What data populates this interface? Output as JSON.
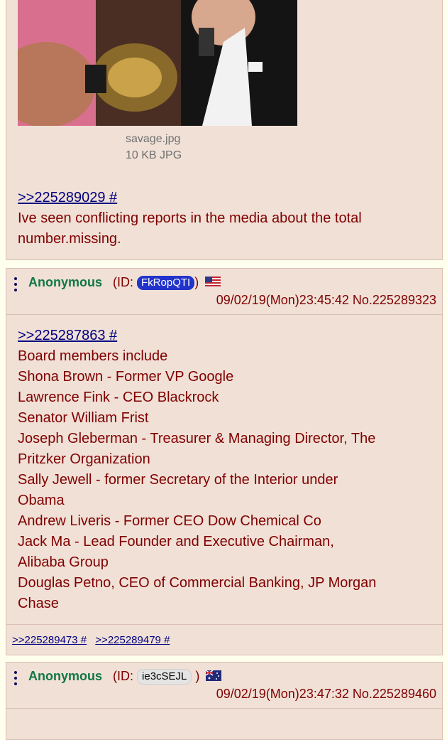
{
  "post1": {
    "file_name": "savage.jpg",
    "file_size": "10 KB JPG",
    "quote": ">>225289029 #",
    "message_lines": [
      "Ive seen conflicting reports in the media about the total",
      "number.missing."
    ]
  },
  "post2": {
    "name": "Anonymous",
    "id_prefix": "(ID:",
    "id": "FkRopQTI",
    "id_suffix": ")",
    "flag_icon": "us-flag-icon",
    "datetime": "09/02/19(Mon)23:45:42",
    "post_no": "No.225289323",
    "quote": ">>225287863 #",
    "message_lines": [
      "Board members include",
      "Shona Brown - Former VP Google",
      "Lawrence Fink - CEO Blackrock",
      "Senator William Frist",
      "Joseph Gleberman - Treasurer & Managing Director, The",
      "Pritzker Organization",
      "Sally Jewell - former Secretary of the Interior under",
      "Obama",
      "Andrew Liveris - Former CEO Dow Chemical Co",
      "Jack Ma - Lead Founder and Executive Chairman,",
      "Alibaba Group",
      "Douglas Petno, CEO of Commercial Banking, JP Morgan",
      "Chase"
    ],
    "backlinks": [
      ">>225289473 #",
      ">>225289479 #"
    ]
  },
  "post3": {
    "name": "Anonymous",
    "id_prefix": "(ID:",
    "id": "ie3cSEJL",
    "id_suffix": ")",
    "flag_icon": "au-flag-icon",
    "datetime": "09/02/19(Mon)23:47:32",
    "post_no": "No.225289460"
  },
  "colors": {
    "post_bg": "#f0e0d6",
    "name": "#117743",
    "text": "#800000",
    "link": "#000080"
  }
}
